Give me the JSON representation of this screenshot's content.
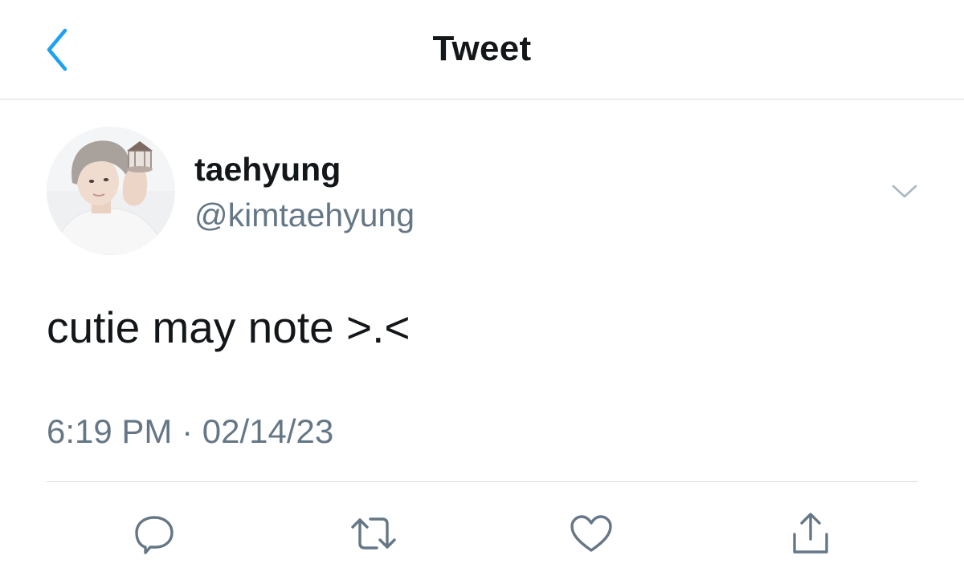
{
  "nav": {
    "title": "Tweet",
    "back_icon": "chevron-left-icon"
  },
  "colors": {
    "accent": "#1da1f2",
    "text_primary": "#14171a",
    "text_secondary": "#657786",
    "divider": "#d9dde1"
  },
  "tweet": {
    "author": {
      "display_name": "taehyung",
      "handle": "@kimtaehyung"
    },
    "text": "cutie may note >.<",
    "timestamp": "6:19 PM · 02/14/23",
    "actions": [
      {
        "icon": "reply-icon"
      },
      {
        "icon": "retweet-icon"
      },
      {
        "icon": "like-icon"
      },
      {
        "icon": "share-icon"
      }
    ]
  }
}
